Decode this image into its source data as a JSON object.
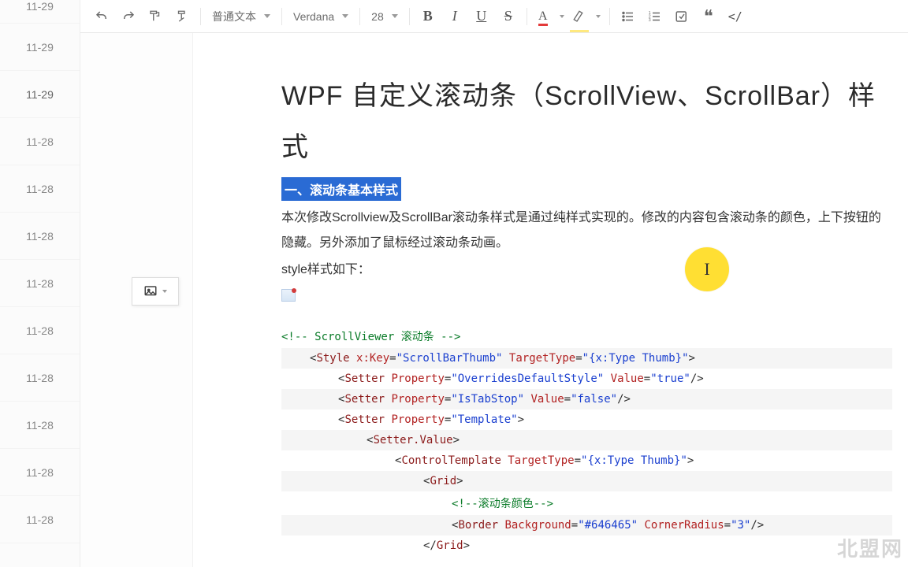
{
  "sidebar": {
    "items": [
      {
        "label": "11-29"
      },
      {
        "label": "11-29"
      },
      {
        "label": "11-29"
      },
      {
        "label": "11-28"
      },
      {
        "label": "11-28"
      },
      {
        "label": "11-28"
      },
      {
        "label": "11-28"
      },
      {
        "label": "11-28"
      },
      {
        "label": "11-28"
      },
      {
        "label": "11-28"
      },
      {
        "label": "11-28"
      },
      {
        "label": "11-28"
      }
    ],
    "active_index": 2
  },
  "toolbar": {
    "block_style": "普通文本",
    "font_family": "Verdana",
    "font_size": "28",
    "bold": "B",
    "italic": "I",
    "underline": "U",
    "strike": "S",
    "font_color_letter": "A",
    "quote_glyph": "❝",
    "code_glyph": "</"
  },
  "doc": {
    "title": "WPF 自定义滚动条（ScrollView、ScrollBar）样式",
    "section_heading": "一、滚动条基本样式",
    "para1": "本次修改Scrollview及ScrollBar滚动条样式是通过纯样式实现的。修改的内容包含滚动条的颜色，上下按钮的隐藏。另外添加了鼠标经过滚动条动画。",
    "para2": "style样式如下：",
    "code_lines": [
      {
        "indent": 0,
        "segments": [
          {
            "cls": "c-comment",
            "text": "<!-- ScrollViewer 滚动条 -->"
          }
        ]
      },
      {
        "indent": 1,
        "segments": [
          {
            "cls": "c-punc",
            "text": "<"
          },
          {
            "cls": "c-tag",
            "text": "Style "
          },
          {
            "cls": "c-attr",
            "text": "x:Key"
          },
          {
            "cls": "c-punc",
            "text": "="
          },
          {
            "cls": "c-val",
            "text": "\"ScrollBarThumb\""
          },
          {
            "cls": "c-punc",
            "text": " "
          },
          {
            "cls": "c-attr",
            "text": "TargetType"
          },
          {
            "cls": "c-punc",
            "text": "="
          },
          {
            "cls": "c-val",
            "text": "\"{x:Type Thumb}\""
          },
          {
            "cls": "c-punc",
            "text": ">"
          }
        ]
      },
      {
        "indent": 2,
        "segments": [
          {
            "cls": "c-punc",
            "text": "<"
          },
          {
            "cls": "c-tag",
            "text": "Setter "
          },
          {
            "cls": "c-attr",
            "text": "Property"
          },
          {
            "cls": "c-punc",
            "text": "="
          },
          {
            "cls": "c-val",
            "text": "\"OverridesDefaultStyle\""
          },
          {
            "cls": "c-punc",
            "text": " "
          },
          {
            "cls": "c-attr",
            "text": "Value"
          },
          {
            "cls": "c-punc",
            "text": "="
          },
          {
            "cls": "c-val",
            "text": "\"true\""
          },
          {
            "cls": "c-punc",
            "text": "/>"
          }
        ]
      },
      {
        "indent": 2,
        "segments": [
          {
            "cls": "c-punc",
            "text": "<"
          },
          {
            "cls": "c-tag",
            "text": "Setter "
          },
          {
            "cls": "c-attr",
            "text": "Property"
          },
          {
            "cls": "c-punc",
            "text": "="
          },
          {
            "cls": "c-val",
            "text": "\"IsTabStop\""
          },
          {
            "cls": "c-punc",
            "text": " "
          },
          {
            "cls": "c-attr",
            "text": "Value"
          },
          {
            "cls": "c-punc",
            "text": "="
          },
          {
            "cls": "c-val",
            "text": "\"false\""
          },
          {
            "cls": "c-punc",
            "text": "/>"
          }
        ]
      },
      {
        "indent": 2,
        "segments": [
          {
            "cls": "c-punc",
            "text": "<"
          },
          {
            "cls": "c-tag",
            "text": "Setter "
          },
          {
            "cls": "c-attr",
            "text": "Property"
          },
          {
            "cls": "c-punc",
            "text": "="
          },
          {
            "cls": "c-val",
            "text": "\"Template\""
          },
          {
            "cls": "c-punc",
            "text": ">"
          }
        ]
      },
      {
        "indent": 3,
        "segments": [
          {
            "cls": "c-punc",
            "text": "<"
          },
          {
            "cls": "c-tag",
            "text": "Setter.Value"
          },
          {
            "cls": "c-punc",
            "text": ">"
          }
        ]
      },
      {
        "indent": 4,
        "segments": [
          {
            "cls": "c-punc",
            "text": "<"
          },
          {
            "cls": "c-tag",
            "text": "ControlTemplate "
          },
          {
            "cls": "c-attr",
            "text": "TargetType"
          },
          {
            "cls": "c-punc",
            "text": "="
          },
          {
            "cls": "c-val",
            "text": "\"{x:Type Thumb}\""
          },
          {
            "cls": "c-punc",
            "text": ">"
          }
        ]
      },
      {
        "indent": 5,
        "segments": [
          {
            "cls": "c-punc",
            "text": "<"
          },
          {
            "cls": "c-tag",
            "text": "Grid"
          },
          {
            "cls": "c-punc",
            "text": ">"
          }
        ]
      },
      {
        "indent": 6,
        "segments": [
          {
            "cls": "c-comment",
            "text": "<!--滚动条颜色-->"
          }
        ]
      },
      {
        "indent": 6,
        "segments": [
          {
            "cls": "c-punc",
            "text": "<"
          },
          {
            "cls": "c-tag",
            "text": "Border "
          },
          {
            "cls": "c-attr",
            "text": "Background"
          },
          {
            "cls": "c-punc",
            "text": "="
          },
          {
            "cls": "c-val",
            "text": "\"#646465\""
          },
          {
            "cls": "c-punc",
            "text": " "
          },
          {
            "cls": "c-attr",
            "text": "CornerRadius"
          },
          {
            "cls": "c-punc",
            "text": "="
          },
          {
            "cls": "c-val",
            "text": "\"3\""
          },
          {
            "cls": "c-punc",
            "text": "/>"
          }
        ]
      },
      {
        "indent": 5,
        "segments": [
          {
            "cls": "c-punc",
            "text": "</"
          },
          {
            "cls": "c-tag",
            "text": "Grid"
          },
          {
            "cls": "c-punc",
            "text": ">"
          }
        ]
      }
    ]
  },
  "watermark": "北盟网"
}
